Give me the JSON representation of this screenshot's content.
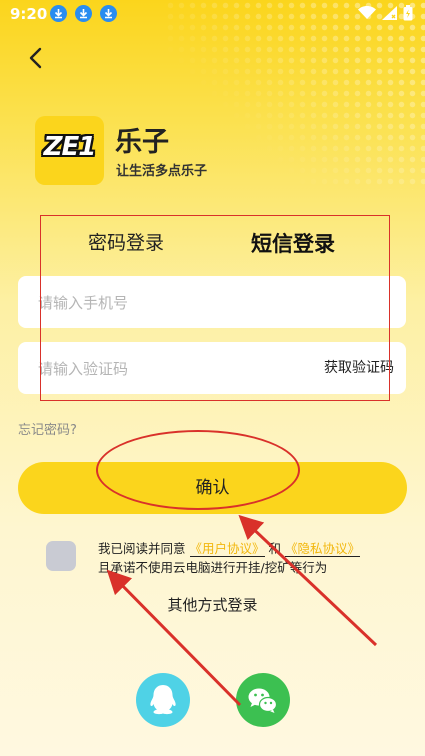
{
  "status_bar": {
    "time": "9:20"
  },
  "app": {
    "name": "乐子",
    "slogan": "让生活多点乐子",
    "logo_text": "ZE1"
  },
  "tabs": [
    {
      "label": "密码登录",
      "active": false
    },
    {
      "label": "短信登录",
      "active": true
    }
  ],
  "form": {
    "phone_placeholder": "请输入手机号",
    "code_placeholder": "请输入验证码",
    "get_code_label": "获取验证码",
    "forgot_label": "忘记密码?",
    "confirm_label": "确认"
  },
  "agreement": {
    "prefix": "我已阅读并同意",
    "user_agreement": "《用户协议》",
    "and": "和",
    "privacy": "《隐私协议》",
    "suffix": "且承诺不使用云电脑进行开挂/挖矿等行为",
    "checked": false
  },
  "other_login": {
    "label": "其他方式登录",
    "methods": [
      "qq-icon",
      "wechat-icon"
    ]
  },
  "colors": {
    "accent": "#fbd51c",
    "annotation": "#d9312a",
    "link": "#f2b70d"
  }
}
